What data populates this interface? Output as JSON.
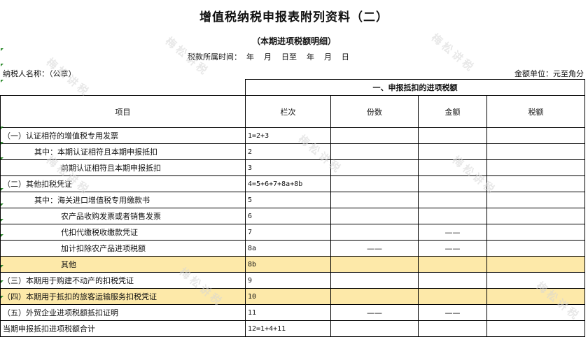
{
  "title": "增值税纳税申报表附列资料（二）",
  "subtitle": "（本期进项税额明细）",
  "period_label": "税款所属时间：  年    月    日至    年    月    日",
  "taxpayer_label": "纳税人名称：（公章）",
  "unit_label": "金额单位：元至角分",
  "section_title": "一、申报抵扣的进项税额",
  "columns": [
    "项目",
    "栏次",
    "份数",
    "金额",
    "税额"
  ],
  "rows": [
    {
      "item": "（一）认证相符的增值税专用发票",
      "col": "1=2+3",
      "count": "",
      "amount": "",
      "tax": ""
    },
    {
      "item": "其中：本期认证相符且本期申报抵扣",
      "col": "2",
      "count": "",
      "amount": "",
      "tax": ""
    },
    {
      "item": "前期认证相符且本期申报抵扣",
      "col": "3",
      "count": "",
      "amount": "",
      "tax": ""
    },
    {
      "item": "（二）其他扣税凭证",
      "col": "4=5+6+7+8a+8b",
      "count": "",
      "amount": "",
      "tax": ""
    },
    {
      "item": "其中：海关进口增值税专用缴款书",
      "col": "5",
      "count": "",
      "amount": "",
      "tax": ""
    },
    {
      "item": "农产品收购发票或者销售发票",
      "col": "6",
      "count": "",
      "amount": "",
      "tax": ""
    },
    {
      "item": "代扣代缴税收缴款凭证",
      "col": "7",
      "count": "",
      "amount": "——",
      "tax": ""
    },
    {
      "item": "加计扣除农产品进项税额",
      "col": "8a",
      "count": "——",
      "amount": "——",
      "tax": ""
    },
    {
      "item": "其他",
      "col": "8b",
      "count": "",
      "amount": "",
      "tax": ""
    },
    {
      "item": "（三）本期用于购建不动产的扣税凭证",
      "col": "9",
      "count": "",
      "amount": "",
      "tax": ""
    },
    {
      "item": "（四）本期用于抵扣的旅客运输服务扣税凭证",
      "col": "10",
      "count": "",
      "amount": "",
      "tax": ""
    },
    {
      "item": "（五）外贸企业进项税额抵扣证明",
      "col": "11",
      "count": "——",
      "amount": "——",
      "tax": ""
    },
    {
      "item": "当期申报抵扣进项税额合计",
      "col": "12=1+4+11",
      "count": "",
      "amount": "",
      "tax": ""
    }
  ],
  "watermark_text": "梅松讲税",
  "colors": {
    "highlight": "#fde9a9",
    "border": "#000000",
    "marker": "#2e8b2e"
  }
}
